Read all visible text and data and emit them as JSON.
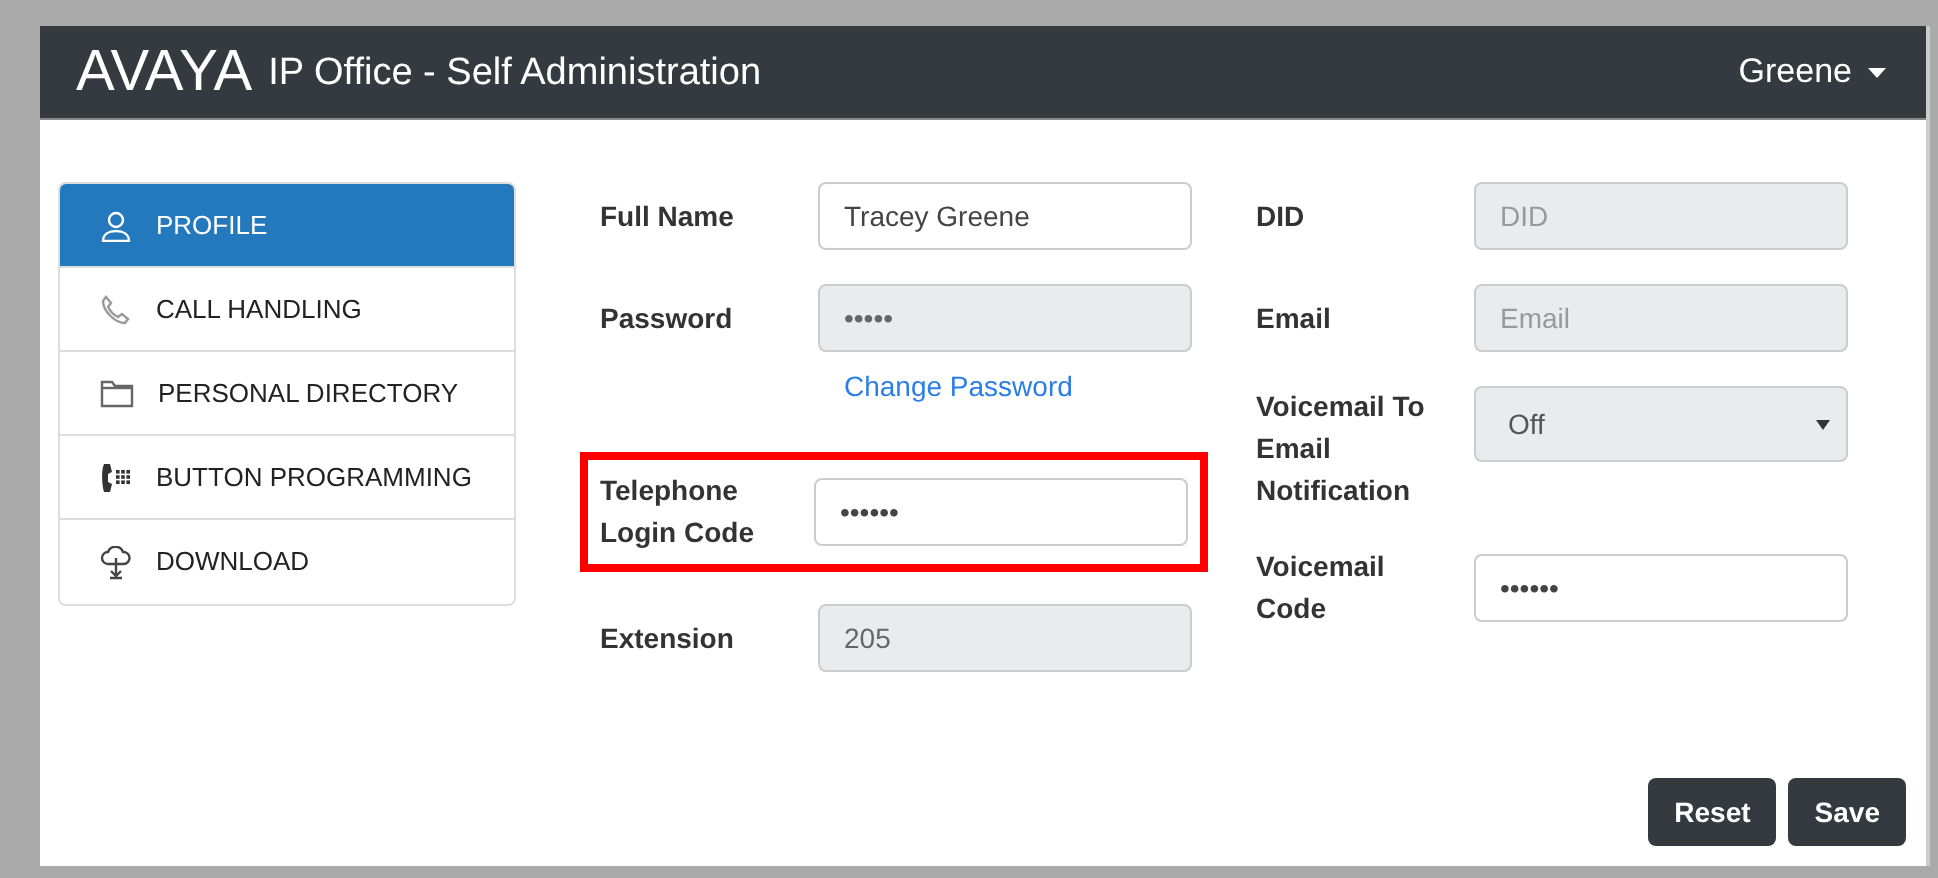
{
  "header": {
    "logo": "AVAYA",
    "title": "IP Office - Self Administration",
    "user": "Greene"
  },
  "sidebar": {
    "items": [
      {
        "label": "PROFILE",
        "selected": true
      },
      {
        "label": "CALL HANDLING",
        "selected": false
      },
      {
        "label": "PERSONAL DIRECTORY",
        "selected": false
      },
      {
        "label": "BUTTON PROGRAMMING",
        "selected": false
      },
      {
        "label": "DOWNLOAD",
        "selected": false
      }
    ]
  },
  "form": {
    "left": [
      {
        "kind": "field",
        "label": "Full Name",
        "value": "Tracey Greene",
        "disabled": false,
        "highlighted": false
      },
      {
        "kind": "field",
        "label": "Password",
        "value": "•••••",
        "disabled": true,
        "highlighted": false,
        "link": "Change Password"
      },
      {
        "kind": "field",
        "label": "Telephone Login Code",
        "value": "••••••",
        "disabled": false,
        "highlighted": true
      },
      {
        "kind": "field",
        "label": "Extension",
        "value": "205",
        "disabled": true,
        "highlighted": false
      }
    ],
    "right": [
      {
        "kind": "field",
        "label": "DID",
        "placeholder": "DID",
        "disabled": true,
        "highlighted": false
      },
      {
        "kind": "field",
        "label": "Email",
        "placeholder": "Email",
        "disabled": true,
        "highlighted": false
      },
      {
        "kind": "select",
        "label": "Voicemail To Email Notification",
        "value": "Off",
        "disabled": true,
        "highlighted": false
      },
      {
        "kind": "field",
        "label": "Voicemail Code",
        "value": "••••••",
        "disabled": false,
        "highlighted": false
      }
    ]
  },
  "buttons": [
    "Reset",
    "Save"
  ]
}
